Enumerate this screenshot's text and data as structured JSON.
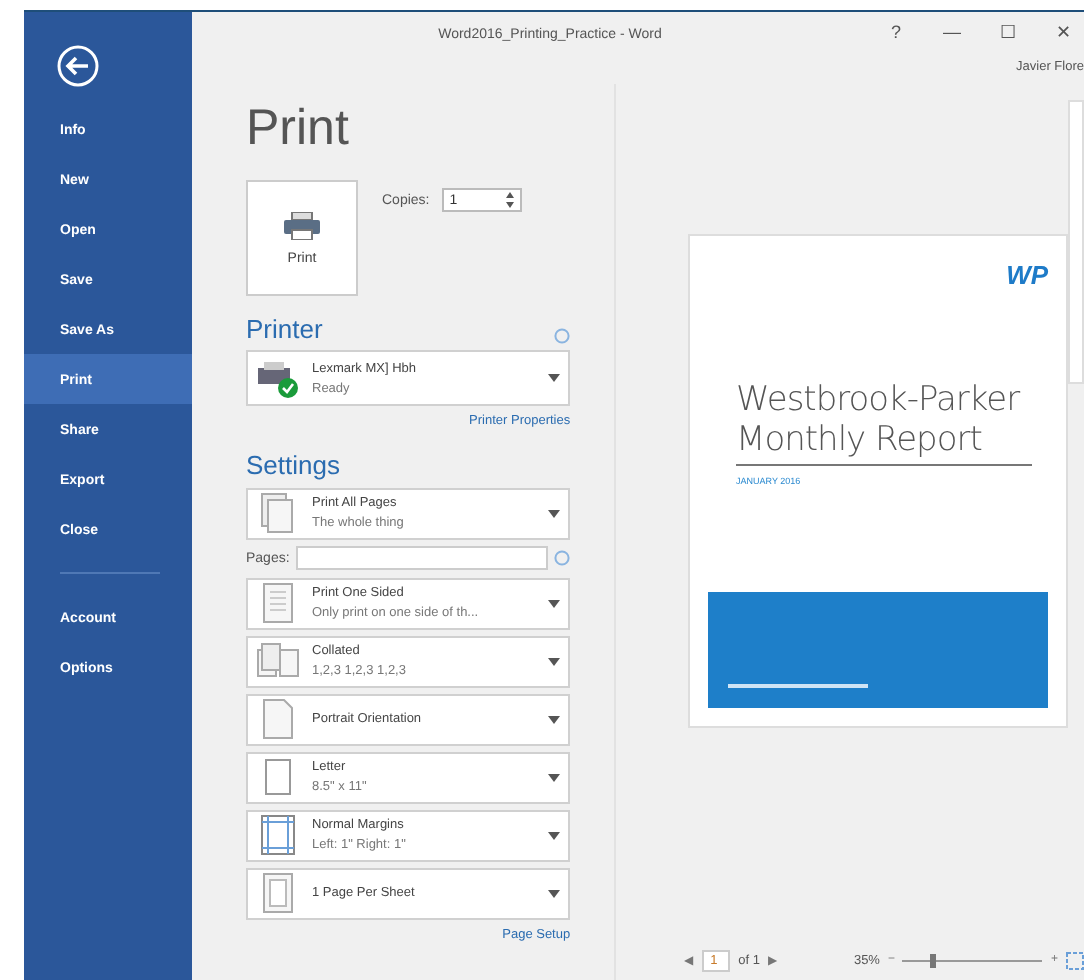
{
  "window": {
    "title": "Word2016_Printing_Practice - Word",
    "controls": [
      "?",
      "—",
      "☐",
      "✕"
    ],
    "user": "Javier Flore"
  },
  "sidebar": {
    "items": [
      {
        "label": "Info",
        "selected": false
      },
      {
        "label": "New",
        "selected": false
      },
      {
        "label": "Open",
        "selected": false
      },
      {
        "label": "Save",
        "selected": false
      },
      {
        "label": "Save As",
        "selected": false
      },
      {
        "label": "Print",
        "selected": true
      },
      {
        "label": "Share",
        "selected": false
      },
      {
        "label": "Export",
        "selected": false
      },
      {
        "label": "Close",
        "selected": false
      }
    ],
    "footer_items": [
      {
        "label": "Account",
        "selected": false
      },
      {
        "label": "Options",
        "selected": false
      }
    ]
  },
  "heading": "Print",
  "print_button": "Print",
  "copies": {
    "label": "Copies:",
    "value": "1"
  },
  "printer": {
    "heading": "Printer",
    "name": "Lexmark MX] Hbh",
    "status": "Ready",
    "properties_link": "Printer Properties"
  },
  "settings": {
    "heading": "Settings",
    "options": [
      {
        "kind": "pages",
        "title": "Print All Pages",
        "subtitle": "The whole thing"
      },
      {
        "kind": "pages_field",
        "label": "Pages:"
      },
      {
        "kind": "sides",
        "title": "Print One Sided",
        "subtitle": "Only print on one side of th..."
      },
      {
        "kind": "collate",
        "title": "Collated",
        "subtitle": "1,2,3    1,2,3    1,2,3"
      },
      {
        "kind": "orientation",
        "title": "Portrait Orientation"
      },
      {
        "kind": "paper",
        "title": "Letter",
        "subtitle": "8.5\" x 11\""
      },
      {
        "kind": "margins",
        "title": "Normal Margins",
        "subtitle": "Left:  1\"    Right:  1\""
      },
      {
        "kind": "sheet",
        "title": "1 Page Per Sheet"
      }
    ],
    "page_setup_link": "Page Setup"
  },
  "preview": {
    "logo": "WP",
    "title": "Westbrook-Parker",
    "subtitle": "Monthly Report",
    "date": "JANUARY 2016"
  },
  "navigation": {
    "prev": "◀",
    "page": "1",
    "of": "of 1",
    "next": "▶",
    "zoom": "35%",
    "minus": "−",
    "plus": "+",
    "level": 0.2
  }
}
